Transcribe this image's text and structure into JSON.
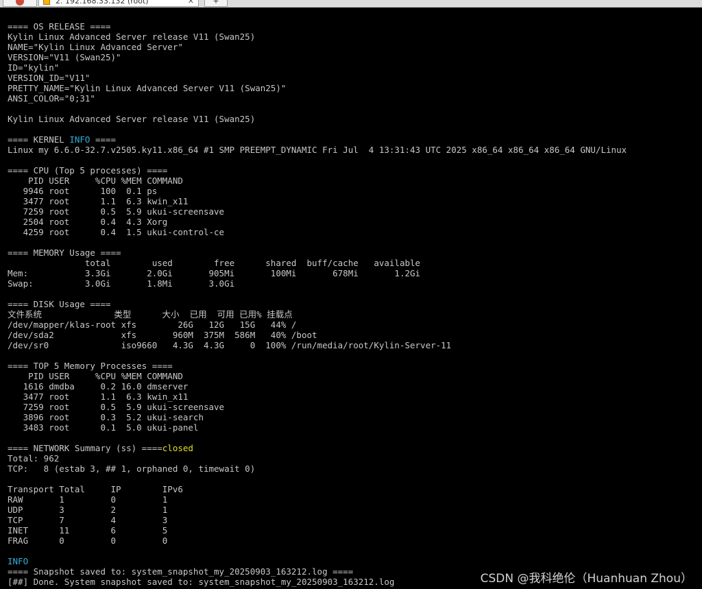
{
  "tabs": {
    "session_label": "2. 192.168.33.132 (root)",
    "new_tab_label": "+"
  },
  "terminal": {
    "lines": [
      "==== OS RELEASE ====",
      "Kylin Linux Advanced Server release V11 (Swan25)",
      "NAME=\"Kylin Linux Advanced Server\"",
      "VERSION=\"V11 (Swan25)\"",
      "ID=\"kylin\"",
      "VERSION_ID=\"V11\"",
      "PRETTY_NAME=\"Kylin Linux Advanced Server V11 (Swan25)\"",
      "ANSI_COLOR=\"0;31\"",
      "",
      "Kylin Linux Advanced Server release V11 (Swan25)",
      "",
      "==== KERNEL ## ====",
      "Linux my 6.6.0-32.7.v2505.ky11.x86_64 #1 SMP PREEMPT_DYNAMIC Fri Jul  4 13:31:43 UTC 2025 x86_64 x86_64 x86_64 GNU/Linux",
      "",
      "==== CPU (Top 5 processes) ====",
      "    PID USER     %CPU %MEM COMMAND",
      "   9946 root      100  0.1 ps",
      "   3477 root      1.1  6.3 kwin_x11",
      "   7259 root      0.5  5.9 ukui-screensave",
      "   2504 root      0.4  4.3 Xorg",
      "   4259 root      0.4  1.5 ukui-control-ce",
      "",
      "==== MEMORY Usage ====",
      "               total        used        free      shared  buff/cache   available",
      "Mem:           3.3Gi       2.0Gi       905Mi       100Mi       678Mi       1.2Gi",
      "Swap:          3.0Gi       1.8Mi       3.0Gi",
      "",
      "==== DISK Usage ====",
      "文件系统              类型      大小  已用  可用 已用% 挂载点",
      "/dev/mapper/klas-root xfs        26G   12G   15G   44% /",
      "/dev/sda2             xfs       960M  375M  586M   40% /boot",
      "/dev/sr0              iso9660   4.3G  4.3G     0  100% /run/media/root/Kylin-Server-11",
      "",
      "==== TOP 5 Memory Processes ====",
      "    PID USER     %CPU %MEM COMMAND",
      "   1616 dmdba     0.2 16.0 dmserver",
      "   3477 root      1.1  6.3 kwin_x11",
      "   7259 root      0.5  5.9 ukui-screensave",
      "   3896 root      0.3  5.2 ukui-search",
      "   3483 root      0.1  5.0 ukui-panel",
      "",
      "==== NETWORK Summary (ss) ====",
      "Total: 962",
      "TCP:   8 (estab 3, ## 1, orphaned 0, timewait 0)",
      "",
      "Transport Total     IP        IPv6",
      "RAW       1         0         1",
      "UDP       3         2         1",
      "TCP       7         4         3",
      "INET      11        6         5",
      "FRAG      0         0         0",
      "",
      "",
      "==== Snapshot saved to: system_snapshot_my_20250903_163212.log ====",
      "[##] Done. System snapshot saved to: system_snapshot_my_20250903_163212.log"
    ],
    "highlights": [
      {
        "line": 11,
        "text": "INFO",
        "color": "cyan"
      },
      {
        "line": 41,
        "text": "closed",
        "color": "yellow"
      },
      {
        "line": 52,
        "text": "INFO",
        "color": "cyan"
      }
    ]
  },
  "watermark": "CSDN @我科绝伦（Huanhuan Zhou）",
  "colors": {
    "background": "#000000",
    "text": "#c8c8c8",
    "cyan": "#35b0d8",
    "yellow": "#e5e025"
  }
}
